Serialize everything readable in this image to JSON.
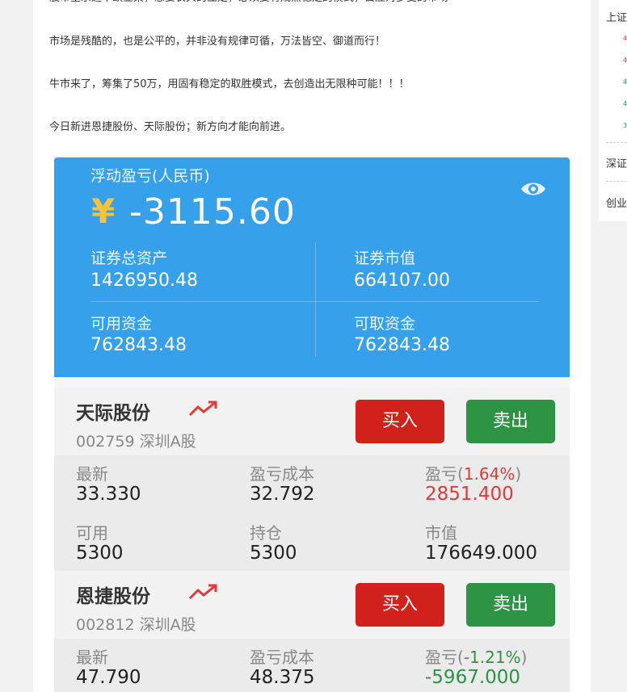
{
  "article": {
    "paragraphs": [
      "股市里永远不缺韭菜，想要长久的立足，必须要有成熟稳定的模式，去应对多变的市场",
      "市场是残酷的，也是公平的，并非没有规律可循，万法皆空、御道而行！",
      "牛市来了，筹集了50万，用固有稳定的取胜模式，去创造出无限种可能！！！",
      "今日新进恩捷股份、天际股份；新方向才能向前进。"
    ]
  },
  "account": {
    "float_label": "浮动盈亏(人民币)",
    "currency_symbol": "¥",
    "float_value": "-3115.60",
    "total_assets_label": "证券总资产",
    "total_assets": "1426950.48",
    "market_value_label": "证券市值",
    "market_value": "664107.00",
    "available_label": "可用资金",
    "available": "762843.48",
    "withdrawable_label": "可取资金",
    "withdrawable": "762843.48"
  },
  "stocks": [
    {
      "name": "天际股份",
      "code_market": "002759 深圳A股",
      "buy_label": "买入",
      "sell_label": "卖出",
      "latest_label": "最新",
      "latest": "33.330",
      "cost_label": "盈亏成本",
      "cost": "32.792",
      "pnl_label": "盈亏",
      "pnl_pct": "1.64%",
      "pnl": "2851.400",
      "usable_label": "可用",
      "usable": "5300",
      "holding_label": "持仓",
      "holding": "5300",
      "mktval_label": "市值",
      "mktval": "176649.000"
    },
    {
      "name": "恩捷股份",
      "code_market": "002812 深圳A股",
      "buy_label": "买入",
      "sell_label": "卖出",
      "latest_label": "最新",
      "latest": "47.790",
      "cost_label": "盈亏成本",
      "cost": "48.375",
      "pnl_label": "盈亏",
      "pnl_pct": "-1.21%",
      "pnl": "-5967.000"
    }
  ],
  "sidebar": {
    "items": [
      "上证",
      "深证",
      "创业"
    ],
    "numbers": [
      "4",
      "4",
      "4",
      "4",
      "3"
    ]
  },
  "colors": {
    "summary_bg": "#36a0ea",
    "up": "#e13a3a",
    "down": "#2c9443",
    "buy": "#d0211b",
    "sell": "#2c9443",
    "yen": "#f6c341"
  }
}
